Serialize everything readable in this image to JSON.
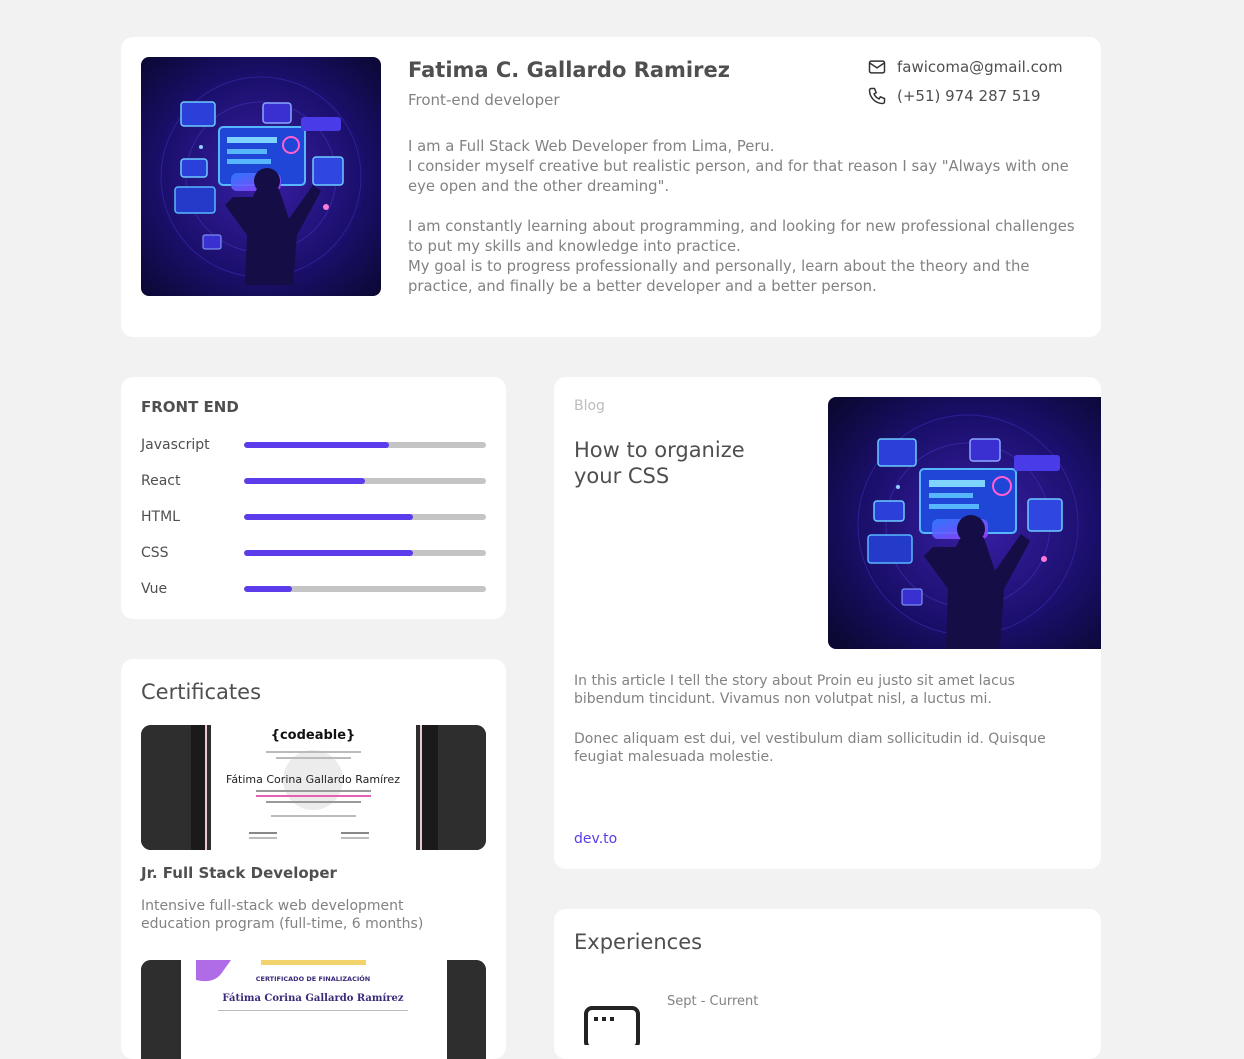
{
  "profile": {
    "name": "Fatima C. Gallardo Ramirez",
    "role": "Front-end developer",
    "email": "fawicoma@gmail.com",
    "phone": "(+51) 974 287 519",
    "bio": [
      "I am a Full Stack Web Developer from Lima, Peru.",
      "I consider myself creative but realistic person, and for that reason I say \"Always with one eye open and the other dreaming\".",
      "I am constantly learning about programming, and looking for new professional challenges to put my skills and knowledge into practice.",
      "My goal is to progress professionally and personally, learn about the theory and the practice, and finally be a better developer and a better person."
    ]
  },
  "skills": {
    "title": "FRONT END",
    "items": [
      {
        "name": "Javascript",
        "level": 0.6
      },
      {
        "name": "React",
        "level": 0.5
      },
      {
        "name": "HTML",
        "level": 0.7
      },
      {
        "name": "CSS",
        "level": 0.7
      },
      {
        "name": "Vue",
        "level": 0.2
      }
    ]
  },
  "certificates": {
    "title": "Certificates",
    "items": [
      {
        "name": "Jr. Full Stack Developer",
        "description": "Intensive full-stack web development education program (full-time, 6 months)",
        "image_brand": "{codeable}",
        "image_recipient": "Fátima Corina Gallardo Ramírez"
      },
      {
        "image_heading": "CERTIFICADO DE FINALIZACIÓN",
        "image_recipient": "Fátima Corina Gallardo Ramírez"
      }
    ]
  },
  "blog": {
    "label": "Blog",
    "title": "How to organize your CSS",
    "paragraphs": [
      "In this article I tell the story about Proin eu justo sit amet lacus bibendum tincidunt. Vivamus non volutpat nisl, a luctus mi.",
      "Donec aliquam est dui, vel vestibulum diam sollicitudin id. Quisque feugiat malesuada molestie."
    ],
    "link": "dev.to"
  },
  "experiences": {
    "title": "Experiences",
    "items": [
      {
        "date": "Sept - Current"
      }
    ]
  },
  "colors": {
    "accent": "#5b3bea",
    "track": "#c4c4c4",
    "background": "#f2f2f2",
    "card": "#ffffff"
  }
}
